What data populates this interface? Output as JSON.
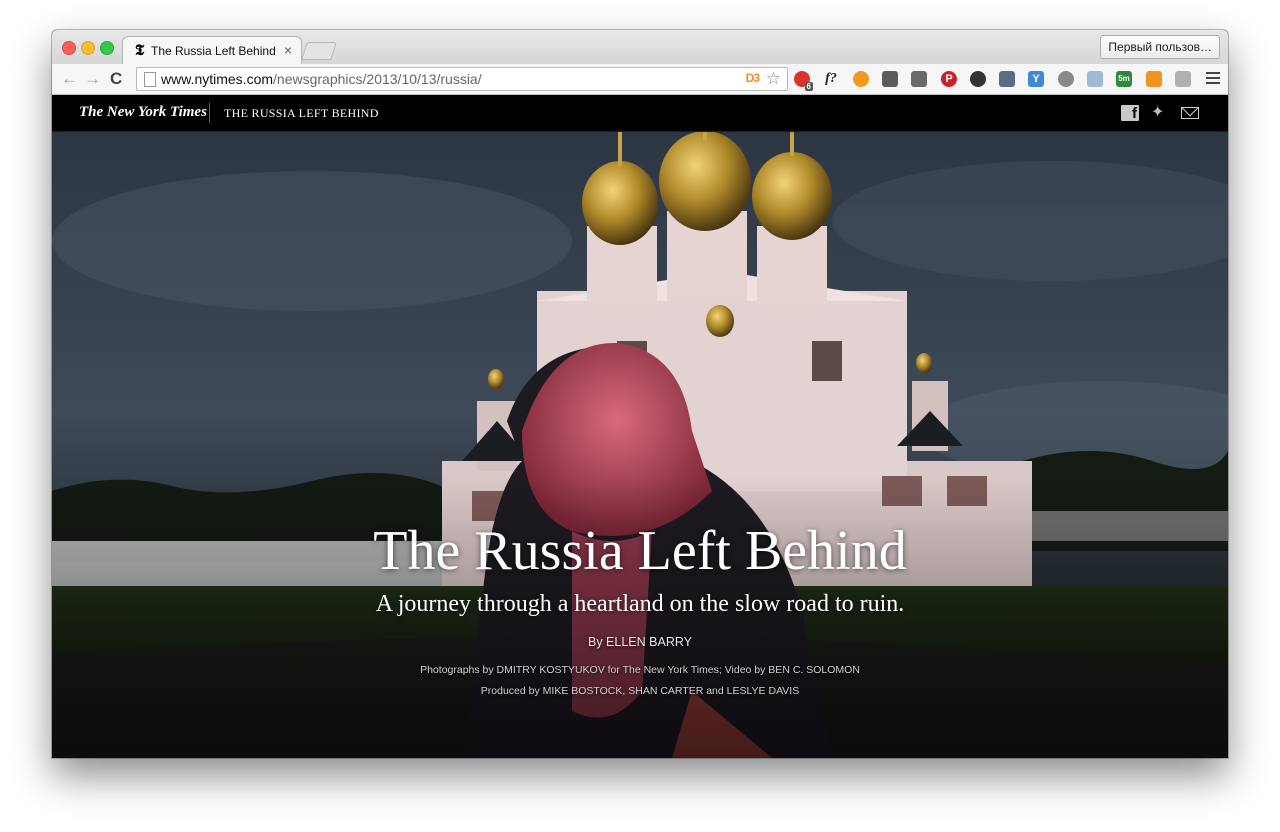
{
  "browser": {
    "tab_title": "The Russia Left Behind",
    "tab_close": "×",
    "profile_button": "Первый пользов…",
    "url_host": "www.nytimes.com",
    "url_path": "/newsgraphics/2013/10/13/russia/",
    "nav_back": "←",
    "nav_forward": "→",
    "nav_reload": "C",
    "d3_icon_text": "D3",
    "star": "☆",
    "extensions": [
      {
        "name": "adblock-icon",
        "color": "#d9342b",
        "text": "",
        "badge": "6"
      },
      {
        "name": "fx-icon",
        "color": "#f6f6f6",
        "text": "f?"
      },
      {
        "name": "flame-icon",
        "color": "#f39a1e",
        "text": ""
      },
      {
        "name": "evernote-icon",
        "color": "#5b5b5b",
        "text": ""
      },
      {
        "name": "pocket-icon",
        "color": "#6a6a6a",
        "text": ""
      },
      {
        "name": "pinterest-icon",
        "color": "#cb2027",
        "text": "P"
      },
      {
        "name": "color-picker-icon",
        "color": "#333333",
        "text": ""
      },
      {
        "name": "eyedropper-icon",
        "color": "#5a6c86",
        "text": ""
      },
      {
        "name": "y-icon",
        "color": "#3d8ad6",
        "text": "Y"
      },
      {
        "name": "refresh-circle-icon",
        "color": "#8a8a8a",
        "text": ""
      },
      {
        "name": "reader-icon",
        "color": "#9fb9d8",
        "text": ""
      },
      {
        "name": "timer-icon",
        "color": "#2c8a3a",
        "text": "5m"
      },
      {
        "name": "analytics-icon",
        "color": "#f19221",
        "text": ""
      },
      {
        "name": "paw-icon",
        "color": "#b0b0b0",
        "text": ""
      }
    ]
  },
  "masthead": {
    "logo": "The New York Times",
    "section_title": "THE RUSSIA LEFT BEHIND",
    "twitter_glyph": "🐦",
    "facebook_glyph": "f"
  },
  "hero": {
    "title": "The Russia Left Behind",
    "subtitle": "A journey through a heartland on the slow road to ruin.",
    "byline": "By ELLEN BARRY",
    "credit_photos": "Photographs by DMITRY KOSTYUKOV for The New York Times; Video by BEN C. SOLOMON",
    "credit_produced": "Produced by MIKE BOSTOCK, SHAN CARTER and LESLYE DAVIS"
  }
}
